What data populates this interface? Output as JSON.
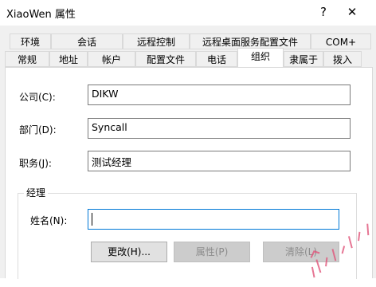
{
  "window": {
    "title": "XiaoWen 属性",
    "help_label": "?",
    "close_label": "✕"
  },
  "tabs_row1": [
    "环境",
    "会话",
    "远程控制",
    "远程桌面服务配置文件",
    "COM+"
  ],
  "tabs_row2": [
    "常规",
    "地址",
    "帐户",
    "配置文件",
    "电话",
    "组织",
    "隶属于",
    "拨入"
  ],
  "active_tab": "组织",
  "form": {
    "company_label": "公司(C):",
    "company_value": "DIKW",
    "department_label": "部门(D):",
    "department_value": "Syncall",
    "title_label": "职务(J):",
    "title_value": "测试经理"
  },
  "manager": {
    "group_label": "经理",
    "name_label": "姓名(N):",
    "name_value": "",
    "change_button": "更改(H)...",
    "properties_button": "属性(P)",
    "clear_button": "清除(L)"
  }
}
